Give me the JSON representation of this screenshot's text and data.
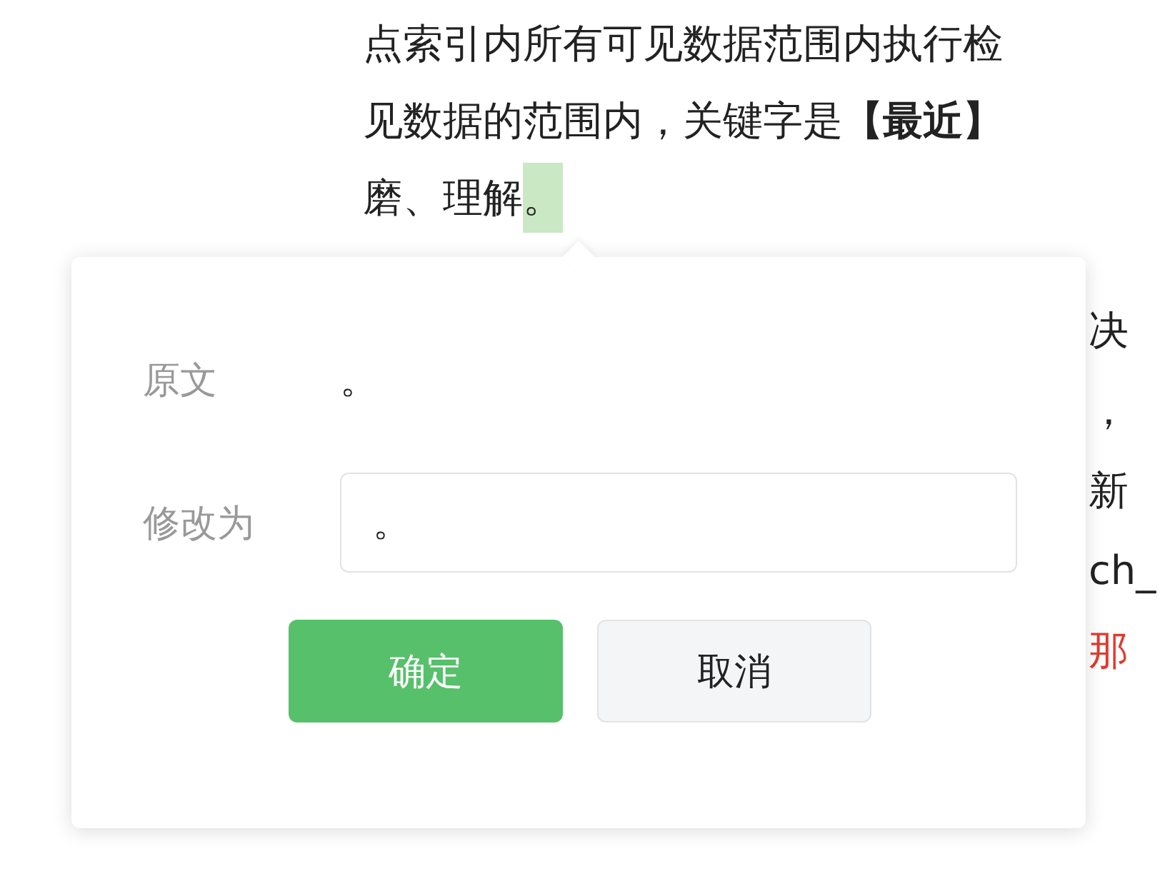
{
  "article": {
    "lines": [
      [
        {
          "text": "点索引内所有可见数据范围内执行检",
          "highlighted": false
        }
      ],
      [
        {
          "text": "见数据的范围内，关键字是**【最近】**",
          "highlighted": false
        }
      ],
      [
        {
          "text": "磨、理解",
          "highlighted": false
        },
        {
          "text": "。",
          "highlighted": true
        }
      ]
    ],
    "fragments": [
      {
        "text": "决",
        "color": "#222222"
      },
      {
        "text": "，",
        "color": "#222222"
      },
      {
        "text": "新",
        "color": "#222222"
      },
      {
        "text": "ch_",
        "color": "#222222"
      },
      {
        "text": "那",
        "color": "#e03a2f"
      }
    ]
  },
  "dialog": {
    "fields": [
      {
        "kind": "text",
        "label": "原文",
        "value": "。"
      },
      {
        "kind": "input",
        "label": "修改为",
        "value": "。"
      }
    ],
    "buttons": [
      {
        "label": "确定",
        "primary": true
      },
      {
        "label": "取消",
        "primary": false
      }
    ]
  }
}
